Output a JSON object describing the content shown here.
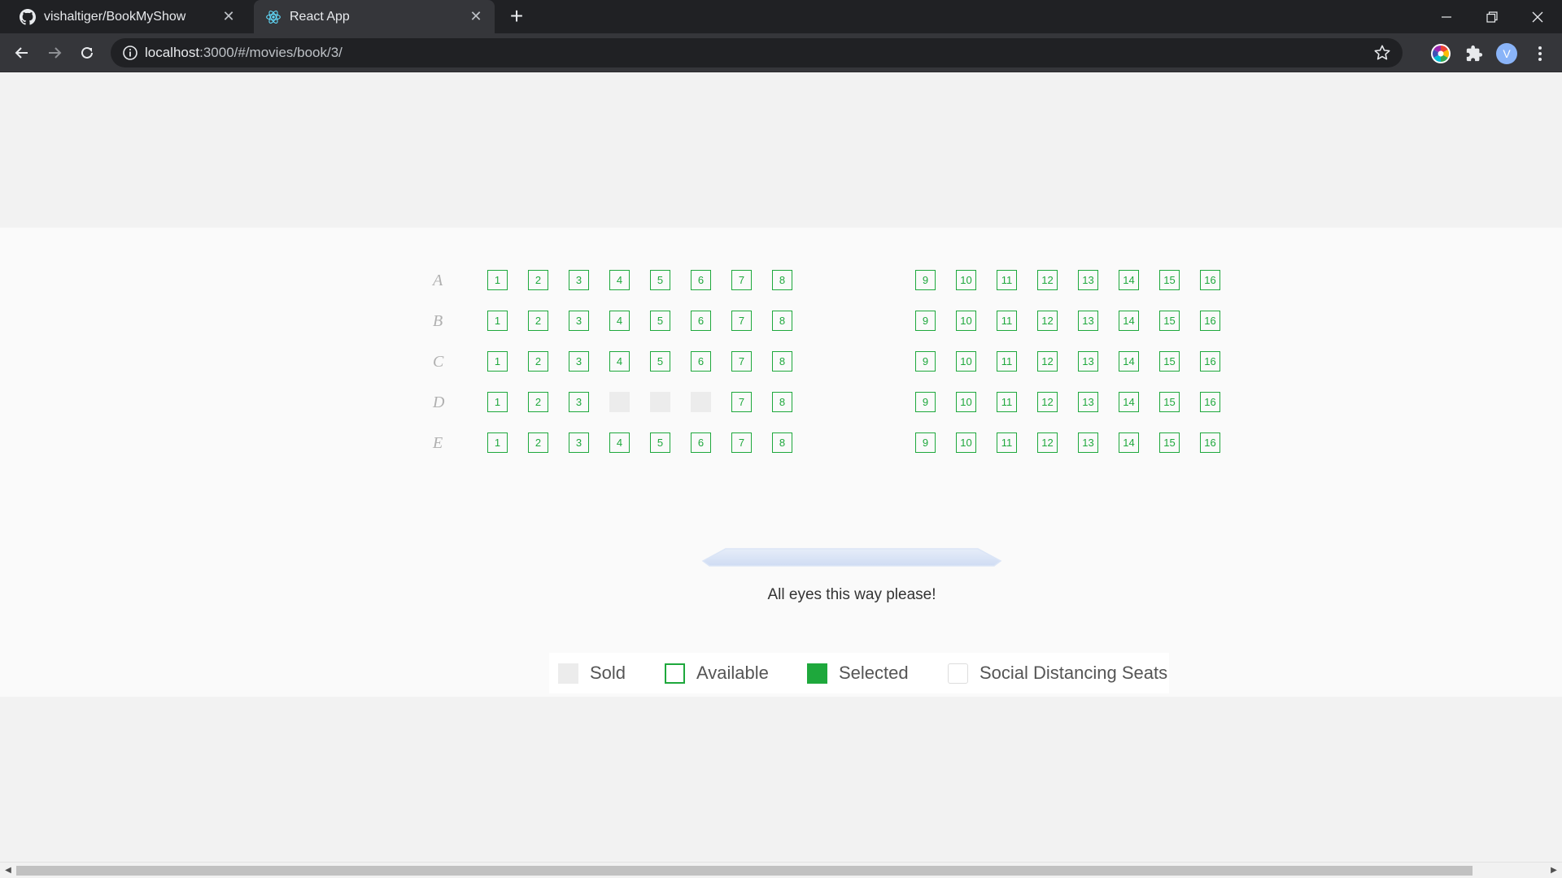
{
  "browser": {
    "tabs": [
      {
        "title": "vishaltiger/BookMyShow",
        "icon": "github-icon",
        "active": false
      },
      {
        "title": "React App",
        "icon": "react-icon",
        "active": true
      }
    ],
    "url_host": "localhost",
    "url_path": ":3000/#/movies/book/3/",
    "profile_initial": "V"
  },
  "theater": {
    "rows": [
      {
        "label": "A",
        "left_seats": [
          "1",
          "2",
          "3",
          "4",
          "5",
          "6",
          "7",
          "8"
        ],
        "right_seats": [
          "9",
          "10",
          "11",
          "12",
          "13",
          "14",
          "15",
          "16"
        ],
        "sold": []
      },
      {
        "label": "B",
        "left_seats": [
          "1",
          "2",
          "3",
          "4",
          "5",
          "6",
          "7",
          "8"
        ],
        "right_seats": [
          "9",
          "10",
          "11",
          "12",
          "13",
          "14",
          "15",
          "16"
        ],
        "sold": []
      },
      {
        "label": "C",
        "left_seats": [
          "1",
          "2",
          "3",
          "4",
          "5",
          "6",
          "7",
          "8"
        ],
        "right_seats": [
          "9",
          "10",
          "11",
          "12",
          "13",
          "14",
          "15",
          "16"
        ],
        "sold": []
      },
      {
        "label": "D",
        "left_seats": [
          "1",
          "2",
          "3",
          "4",
          "5",
          "6",
          "7",
          "8"
        ],
        "right_seats": [
          "9",
          "10",
          "11",
          "12",
          "13",
          "14",
          "15",
          "16"
        ],
        "sold": [
          "4",
          "5",
          "6"
        ]
      },
      {
        "label": "E",
        "left_seats": [
          "1",
          "2",
          "3",
          "4",
          "5",
          "6",
          "7",
          "8"
        ],
        "right_seats": [
          "9",
          "10",
          "11",
          "12",
          "13",
          "14",
          "15",
          "16"
        ],
        "sold": []
      }
    ],
    "screen_caption": "All eyes this way please!"
  },
  "legend": {
    "sold": "Sold",
    "available": "Available",
    "selected": "Selected",
    "social": "Social Distancing Seats"
  },
  "colors": {
    "accent": "#1ea83c",
    "sold": "#ececec"
  }
}
